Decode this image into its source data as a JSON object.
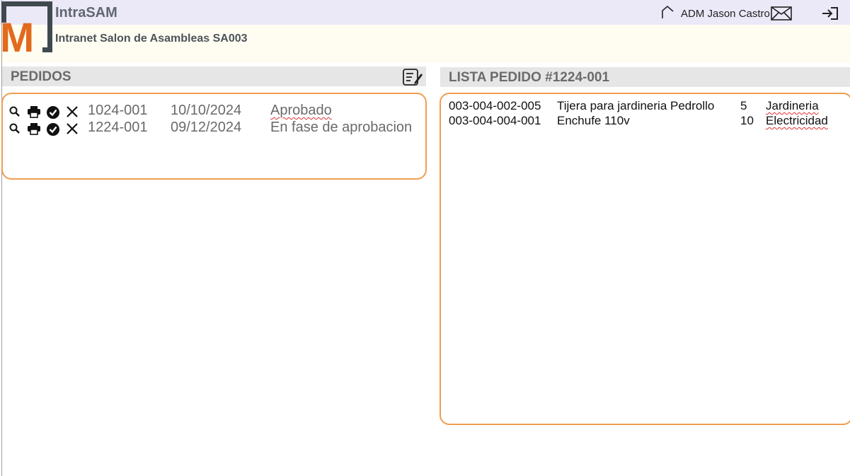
{
  "header": {
    "logo_letter": "M",
    "title": "IntraSAM",
    "subtitle": "Intranet Salon de Asambleas SA003",
    "user_label": "ADM Jason Castro",
    "icons": [
      "home-icon",
      "mail-icon",
      "logout-icon"
    ]
  },
  "pedidos": {
    "title": "PEDIDOS",
    "header_icon": "edit-list-icon",
    "row_icons": [
      "search-icon",
      "print-icon",
      "check-circle-icon",
      "close-icon"
    ],
    "rows": [
      {
        "id": "1024-001",
        "date": "10/10/2024",
        "status": "Aprobado"
      },
      {
        "id": "1224-001",
        "date": "09/12/2024",
        "status": "En fase de aprobacion"
      }
    ]
  },
  "lista": {
    "title": "LISTA PEDIDO #1224-001",
    "items": [
      {
        "code": "003-004-002-005",
        "description": "Tijera para jardineria Pedrollo",
        "qty": "5",
        "category": "Jardineria"
      },
      {
        "code": "003-004-004-001",
        "description": "Enchufe 110v",
        "qty": "10",
        "category": "Electricidad"
      }
    ]
  },
  "colors": {
    "topbar": "#ebe8f7",
    "subbar": "#fffdf2",
    "accent_border": "#ef9d4e",
    "logo_orange": "#e26a1c",
    "logo_dark": "#3f4a4f"
  }
}
